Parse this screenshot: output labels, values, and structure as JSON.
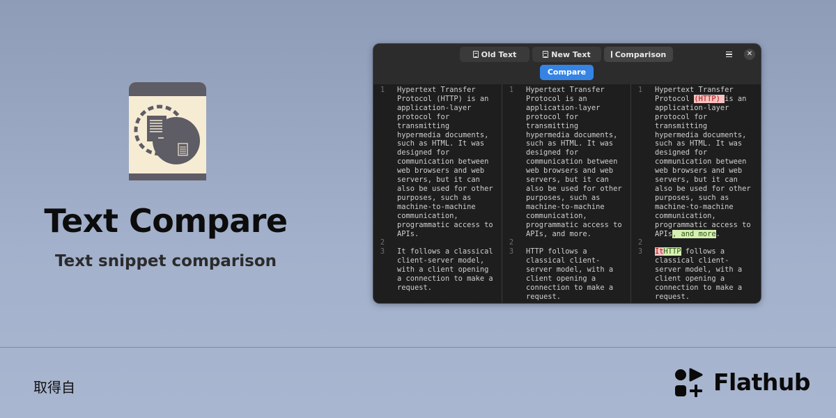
{
  "app": {
    "title": "Text Compare",
    "subtitle": "Text snippet comparison",
    "icon": "text-compare-app-icon"
  },
  "window": {
    "tabs": [
      {
        "label": "Old Text",
        "icon": "document-icon"
      },
      {
        "label": "New Text",
        "icon": "document-icon"
      },
      {
        "label": "Comparison",
        "icon": "document-icon"
      }
    ],
    "compare_label": "Compare",
    "menu_icon": "hamburger-menu-icon",
    "close_icon": "close-icon",
    "close_glyph": "✕"
  },
  "panes": {
    "old": {
      "line_numbers": [
        "1",
        "2",
        "3"
      ],
      "lines": [
        "Hypertext Transfer\nProtocol (HTTP) is an\napplication-layer\nprotocol for\ntransmitting\nhypermedia documents,\nsuch as HTML. It was\ndesigned for\ncommunication between\nweb browsers and web\nservers, but it can\nalso be used for other\npurposes, such as\nmachine-to-machine\ncommunication,\nprogrammatic access to\nAPIs.",
        "",
        "It follows a classical\nclient-server model,\nwith a client opening\na connection to make a\nrequest."
      ]
    },
    "new": {
      "line_numbers": [
        "1",
        "2",
        "3"
      ],
      "lines": [
        "Hypertext Transfer\nProtocol is an\napplication-layer\nprotocol for\ntransmitting\nhypermedia documents,\nsuch as HTML. It was\ndesigned for\ncommunication between\nweb browsers and web\nservers, but it can\nalso be used for other\npurposes, such as\nmachine-to-machine\ncommunication,\nprogrammatic access to\nAPIs, and more.",
        "",
        "HTTP follows a\nclassical client-\nserver model, with a\nclient opening a\nconnection to make a\nrequest."
      ]
    },
    "comparison": {
      "line_numbers": [
        "1",
        "2",
        "3"
      ],
      "segments": [
        {
          "t": "Hypertext Transfer\nProtocol "
        },
        {
          "t": "(HTTP) ",
          "type": "deleted"
        },
        {
          "t": "is an\napplication-layer\nprotocol for\ntransmitting\nhypermedia documents,\nsuch as HTML. It was\ndesigned for\ncommunication between\nweb browsers and web\nservers, but it can\nalso be used for other\npurposes, such as\nmachine-to-machine\ncommunication,\nprogrammatic access to\nAPIs"
        },
        {
          "t": ", and more",
          "type": "inserted"
        },
        {
          "t": ".\n\n"
        },
        {
          "t": "It",
          "type": "deleted"
        },
        {
          "t": "HTTP",
          "type": "inserted"
        },
        {
          "t": " follows a\nclassical client-\nserver model, with a\nclient opening a\nconnection to make a\nrequest."
        }
      ]
    }
  },
  "footer": {
    "label": "取得自",
    "brand": "Flathub",
    "brand_icon": "flathub-logo-icon"
  },
  "colors": {
    "accent": "#3584e4",
    "deleted_bg": "#f6c2c2",
    "deleted_fg": "#b01010",
    "inserted_bg": "#d8efb4",
    "inserted_fg": "#2b5a10"
  }
}
